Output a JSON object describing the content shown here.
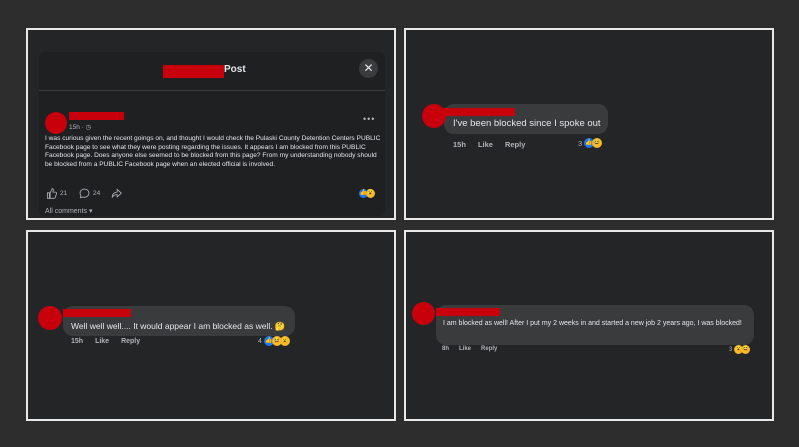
{
  "post": {
    "title": "Post",
    "close_glyph": "✕",
    "time": "15h · ◷",
    "more": "•••",
    "body": "I was curious given the recent goings on, and thought I would check the Pulaski County Detention Centers PUBLIC Facebook page to see what they were posting regarding the issues. It appears I am blocked from this PUBLIC Facebook page. Does anyone else seemed to be blocked from this page? From my understanding nobody should be blocked from a PUBLIC Facebook page when an elected official is involved.",
    "like_count": "21",
    "comment_count": "24",
    "all_comments": "All comments ▾"
  },
  "comments": [
    {
      "text": "I've been blocked since I spoke out",
      "time": "15h",
      "like": "Like",
      "reply": "Reply",
      "reactions": "3"
    },
    {
      "text": "Well well well.... It would appear I am blocked as well. 🤔",
      "time": "15h",
      "like": "Like",
      "reply": "Reply",
      "reactions": "4"
    },
    {
      "text": "I am blocked as well! After I put my 2 weeks in and started a new job 2 years ago, I was blocked!",
      "time": "8h",
      "like": "Like",
      "reply": "Reply",
      "reactions": "3"
    }
  ],
  "colors": {
    "redaction": "#c8000b",
    "bubble": "#3a3b3c",
    "like_blue": "#1877f2",
    "emoji_yellow": "#f7b928"
  },
  "icons": {
    "like": "thumbs-up-icon",
    "comment": "comment-icon",
    "share": "share-icon",
    "close": "close-icon"
  }
}
